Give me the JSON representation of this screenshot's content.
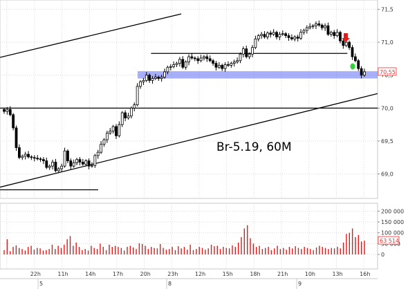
{
  "chart_data": [
    {
      "type": "candlestick",
      "annotation": "Br-5.19, 60M",
      "y_ticks": [
        "71,5",
        "71,0",
        "70,5",
        "70,0",
        "69,5",
        "69,0"
      ],
      "y_tick_values": [
        71.5,
        71.0,
        70.5,
        70.0,
        69.5,
        69.0
      ],
      "ylim": [
        68.65,
        71.62
      ],
      "x_tick_labels": [
        "",
        "22h",
        "11h",
        "14h",
        "17h",
        "20h",
        "23h",
        "12h",
        "15h",
        "18h",
        "21h",
        "10h",
        "13h",
        "16h"
      ],
      "date_labels": [
        "5",
        "8",
        "9"
      ],
      "last_price_label": "70,55",
      "last_price": 70.55,
      "support_zone": [
        70.46,
        70.55
      ],
      "horizontal_levels": [
        {
          "value": 70.0,
          "from": 0,
          "to": 1
        },
        {
          "value": 70.83,
          "from": 0.4,
          "to": 0.92
        },
        {
          "value": 68.76,
          "from": 0,
          "to": 0.26
        }
      ],
      "channel_lines": [
        {
          "x": [
            0,
            0.48
          ],
          "y": [
            70.77,
            71.43
          ]
        },
        {
          "x": [
            0,
            1
          ],
          "y": [
            68.8,
            70.22
          ]
        }
      ],
      "closes": [
        69.95,
        69.98,
        69.9,
        69.7,
        69.4,
        69.25,
        69.27,
        69.3,
        69.26,
        69.25,
        69.24,
        69.23,
        69.22,
        69.2,
        69.1,
        69.12,
        69.18,
        69.05,
        69.08,
        69.12,
        69.35,
        69.2,
        69.12,
        69.17,
        69.22,
        69.18,
        69.15,
        69.2,
        69.12,
        69.13,
        69.28,
        69.33,
        69.45,
        69.52,
        69.62,
        69.65,
        69.72,
        69.58,
        69.75,
        69.93,
        69.85,
        69.88,
        70.0,
        70.05,
        70.33,
        70.4,
        70.42,
        70.5,
        70.42,
        70.45,
        70.47,
        70.45,
        70.47,
        70.55,
        70.62,
        70.63,
        70.66,
        70.68,
        70.74,
        70.62,
        70.7,
        70.78,
        70.76,
        70.75,
        70.72,
        70.76,
        70.78,
        70.75,
        70.72,
        70.68,
        70.62,
        70.65,
        70.6,
        70.66,
        70.65,
        70.68,
        70.7,
        70.72,
        70.82,
        70.9,
        70.78,
        70.82,
        70.92,
        71.05,
        71.1,
        71.12,
        71.08,
        71.14,
        71.12,
        71.15,
        71.08,
        71.12,
        71.13,
        71.1,
        71.07,
        71.05,
        71.08,
        71.06,
        71.15,
        71.18,
        71.22,
        71.24,
        71.25,
        71.28,
        71.26,
        71.22,
        71.25,
        71.12,
        71.15,
        71.1,
        71.15,
        71.02,
        70.95,
        71.0,
        70.92,
        70.78,
        70.72,
        70.6,
        70.5,
        70.55
      ],
      "volume": {
        "y_ticks": [
          "200 000",
          "150 000",
          "100 000",
          "50 000",
          "0"
        ],
        "y_tick_values": [
          200000,
          150000,
          100000,
          50000,
          0
        ],
        "last_label": "63 514",
        "last_value": 63514,
        "values": [
          20000,
          70000,
          15000,
          35000,
          42000,
          30000,
          25000,
          18000,
          35000,
          40000,
          22000,
          30000,
          28000,
          18000,
          20000,
          25000,
          45000,
          25000,
          40000,
          30000,
          45000,
          70000,
          85000,
          40000,
          55000,
          35000,
          20000,
          25000,
          18000,
          40000,
          30000,
          25000,
          50000,
          35000,
          20000,
          45000,
          35000,
          40000,
          35000,
          30000,
          18000,
          35000,
          40000,
          32000,
          25000,
          52000,
          48000,
          40000,
          25000,
          35000,
          30000,
          28000,
          48000,
          30000,
          22000,
          25000,
          35000,
          20000,
          38000,
          28000,
          35000,
          22000,
          45000,
          20000,
          25000,
          35000,
          30000,
          22000,
          28000,
          45000,
          38000,
          40000,
          25000,
          35000,
          30000,
          28000,
          42000,
          35000,
          55000,
          80000,
          120000,
          135000,
          75000,
          50000,
          35000,
          40000,
          25000,
          30000,
          35000,
          20000,
          28000,
          40000,
          25000,
          30000,
          22000,
          35000,
          28000,
          38000,
          30000,
          25000,
          35000,
          30000,
          25000,
          20000,
          32000,
          40000,
          35000,
          30000,
          25000,
          30000,
          28000,
          35000,
          28000,
          55000,
          95000,
          100000,
          120000,
          80000,
          90000,
          60000,
          63514
        ]
      }
    }
  ]
}
